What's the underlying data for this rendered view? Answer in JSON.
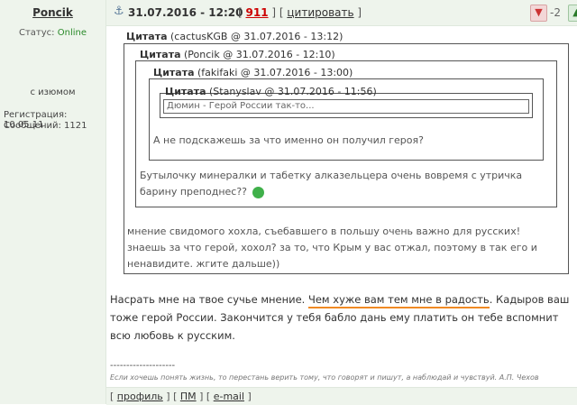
{
  "user": {
    "name": "Poncik",
    "status_label": "Статус:",
    "status_value": "Online",
    "note": "с изюмом",
    "registration": "Регистрация: 10.05.11",
    "messages": "Сообщений: 1121"
  },
  "post": {
    "date": "31.07.2016 - 12:20",
    "number": "911",
    "cite_label": "цитировать",
    "score": "-2",
    "minus_icon": "thumb-down-icon",
    "plus_icon": "thumb-up-icon"
  },
  "quotes": {
    "q1_label": "Цитата",
    "q1_meta": "(cactusKGB @ 31.07.2016 - 13:12)",
    "q2_label": "Цитата",
    "q2_meta": "(Poncik @ 31.07.2016 - 12:10)",
    "q3_label": "Цитата",
    "q3_meta": "(fakifaki @ 31.07.2016 - 13:00)",
    "q4_label": "Цитата",
    "q4_meta": "(Stanyslav @ 31.07.2016 - 11:56)",
    "q4_input": "Дюмин - Герой России так-то...",
    "q3_text": "А не подскажешь за что именно он получил героя?",
    "q2_text": "Бутылочку минералки и табетку алказельцера очень вовремя с утричка барину преподнес??",
    "q1_text": "мнение свидомого хохла, съебавшего в польшу очень важно для русских! знаешь за что герой, хохол? за то, что Крым у вас отжал, поэтому в так его и ненавидите. жгите дальше))"
  },
  "message": {
    "part1": "Насрать мне на твое сучье мнение. ",
    "highlight": "Чем хуже вам тем мне в радость",
    "part2": ". Кадыров ваш тоже герой России. Закончится у тебя бабло дань ему платить он тебе вспомнит всю любовь к русским."
  },
  "signature": {
    "separator": "--------------------",
    "text": "Если хочешь понять жизнь, то перестань верить тому, что говорят и пишут, а наблюдай и чувствуй. А.П. Чехов"
  },
  "footer": {
    "profile": "профиль",
    "pm": "ПМ",
    "email": "e-mail"
  }
}
